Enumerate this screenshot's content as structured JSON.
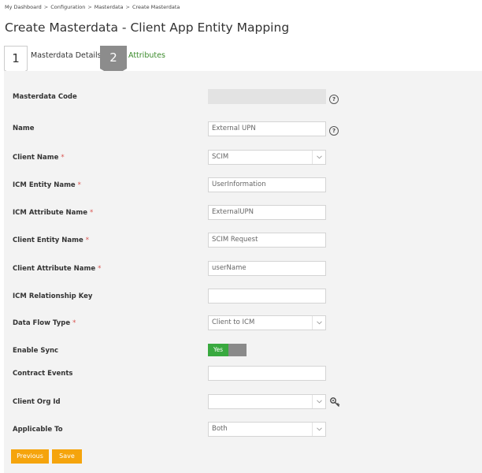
{
  "breadcrumb": {
    "items": [
      "My Dashboard",
      "Configuration",
      "Masterdata",
      "Create Masterdata"
    ],
    "separator": ">"
  },
  "page_title": "Create Masterdata - Client App Entity Mapping",
  "tabs": [
    {
      "number": "1",
      "label": "Masterdata Details",
      "active": true
    },
    {
      "number": "2",
      "label": "Attributes",
      "active": false
    }
  ],
  "form": {
    "masterdata_code": {
      "label": "Masterdata Code",
      "value": "",
      "help": "?"
    },
    "name": {
      "label": "Name",
      "value": "External UPN",
      "help": "?"
    },
    "client_name": {
      "label": "Client Name",
      "required": "*",
      "value": "SCIM"
    },
    "icm_entity_name": {
      "label": "ICM Entity Name",
      "required": "*",
      "value": "UserInformation"
    },
    "icm_attribute_name": {
      "label": "ICM Attribute Name",
      "required": "*",
      "value": "ExternalUPN"
    },
    "client_entity_name": {
      "label": "Client Entity Name",
      "required": "*",
      "value": "SCIM Request"
    },
    "client_attribute_name": {
      "label": "Client Attribute Name",
      "required": "*",
      "value": "userName"
    },
    "icm_relationship_key": {
      "label": "ICM Relationship Key",
      "value": ""
    },
    "data_flow_type": {
      "label": "Data Flow Type",
      "required": "*",
      "value": "Client to ICM"
    },
    "enable_sync": {
      "label": "Enable Sync",
      "toggle_label": "Yes",
      "on": true
    },
    "contract_events": {
      "label": "Contract Events",
      "value": ""
    },
    "client_org_id": {
      "label": "Client Org Id",
      "value": ""
    },
    "applicable_to": {
      "label": "Applicable To",
      "value": "Both"
    }
  },
  "buttons": {
    "previous": "Previous",
    "save": "Save"
  },
  "colors": {
    "accent_green": "#39a93f",
    "button_orange": "#f5a40c",
    "tab_grey": "#8c8c8c",
    "required_red": "#d9534f"
  }
}
